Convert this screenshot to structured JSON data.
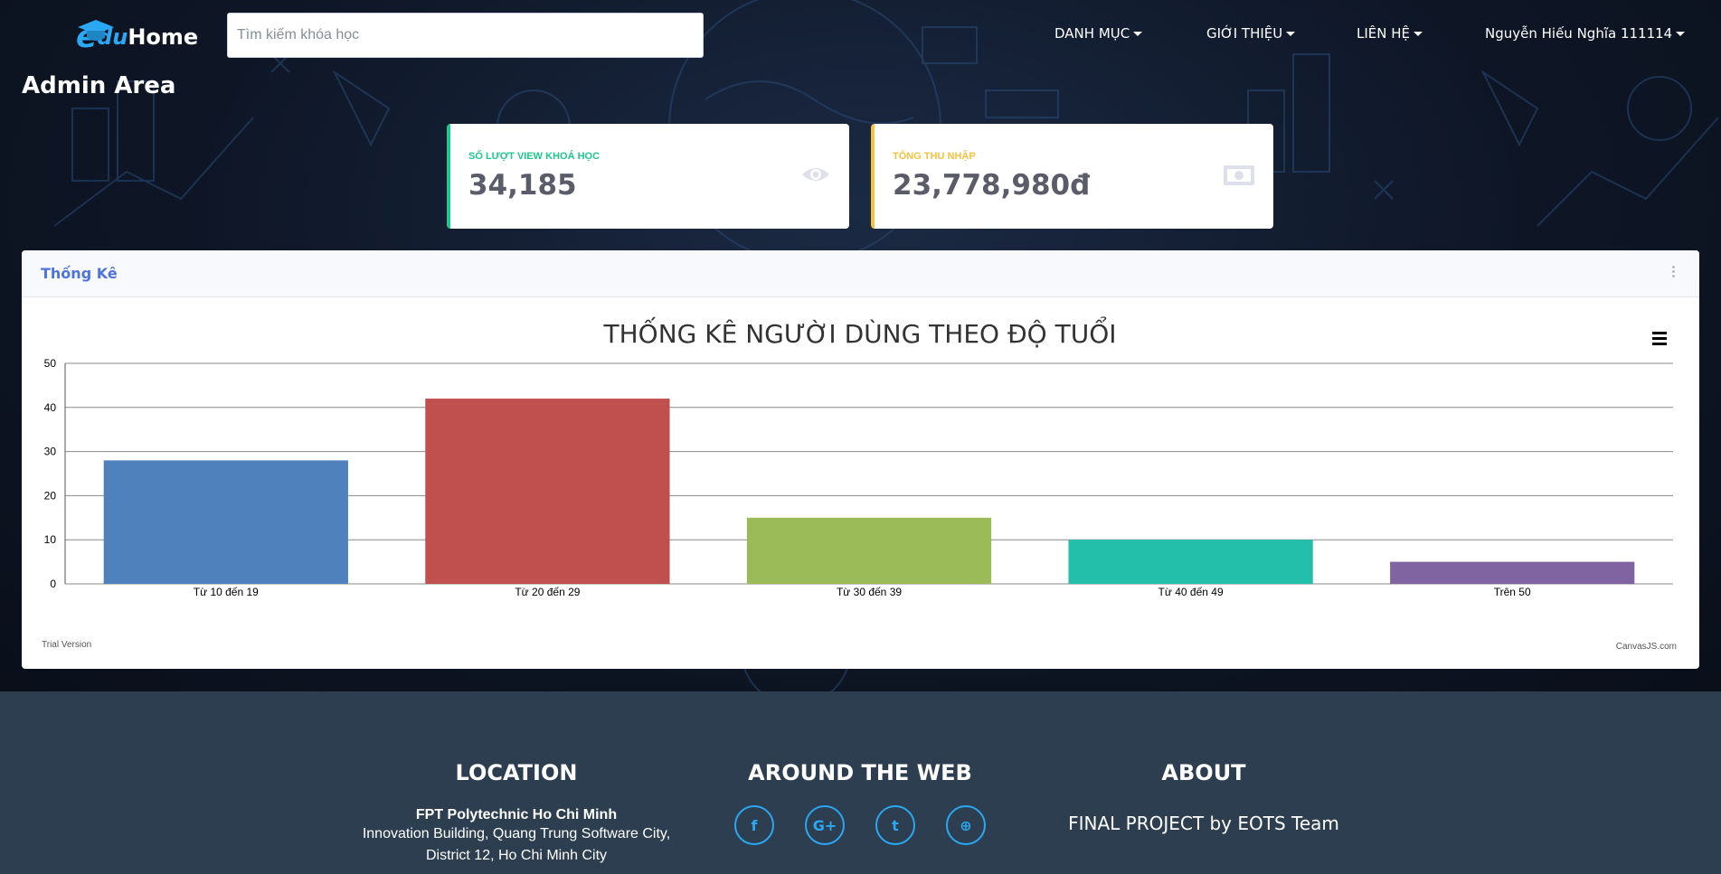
{
  "brand": {
    "e": "e",
    "du": "du",
    "home": "Home"
  },
  "search": {
    "placeholder": "Tìm kiếm khóa học"
  },
  "nav": [
    {
      "label": "DANH MỤC"
    },
    {
      "label": "GIỚI THIỆU"
    },
    {
      "label": "LIÊN HỆ"
    },
    {
      "label": "Nguyễn Hiếu Nghĩa 111114"
    }
  ],
  "admin_title": "Admin Area",
  "cards": [
    {
      "label": "Số lượt view khoá học",
      "value": "34,185",
      "icon": "eye-icon",
      "color": "#1cc88a"
    },
    {
      "label": "Tổng thu nhập",
      "value": "23,778,980đ",
      "icon": "money-bill-icon",
      "color": "#f6c23e"
    }
  ],
  "panel": {
    "title": "Thống Kê"
  },
  "chart_data": {
    "type": "bar",
    "title": "THỐNG KÊ NGƯỜI DÙNG THEO ĐỘ TUỔI",
    "categories": [
      "Từ 10 đến 19",
      "Từ 20 đến 29",
      "Từ 30 đến 39",
      "Từ 40 đến 49",
      "Trên 50"
    ],
    "values": [
      28,
      42,
      15,
      10,
      5
    ],
    "colors": [
      "#4f81bc",
      "#c0504e",
      "#9bbb58",
      "#23bfaa",
      "#8064a1"
    ],
    "ylim": [
      0,
      50
    ],
    "yticks": [
      0,
      10,
      20,
      30,
      40,
      50
    ],
    "grid": true,
    "watermark_left": "Trial Version",
    "watermark_right": "CanvasJS.com"
  },
  "footer": {
    "location": {
      "heading": "LOCATION",
      "name": "FPT Polytechnic Ho Chi Minh",
      "line1": "Innovation Building, Quang Trung Software City,",
      "line2": "District 12, Ho Chi Minh City"
    },
    "web": {
      "heading": "AROUND THE WEB"
    },
    "about": {
      "heading": "ABOUT",
      "text": "FINAL PROJECT by EOTS Team"
    }
  }
}
